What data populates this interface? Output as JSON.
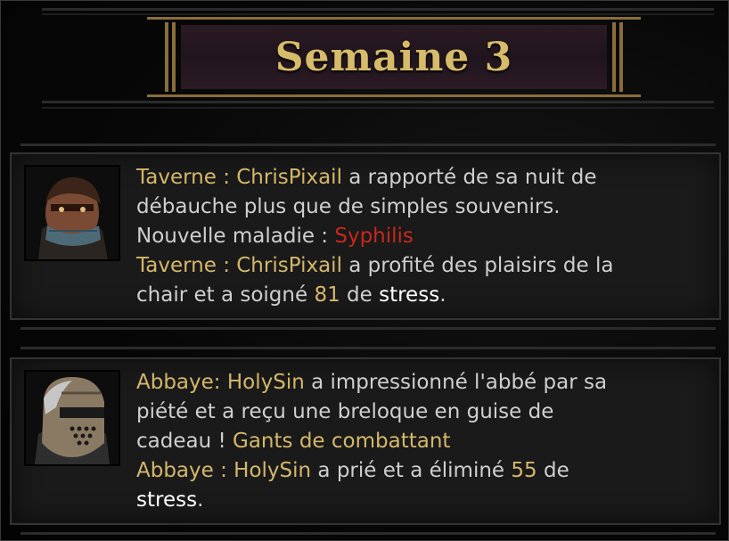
{
  "header": {
    "title": "Semaine 3"
  },
  "events": [
    {
      "hero": "ChrisPixail",
      "portrait_icon": "bandaged-hero-portrait",
      "lines": [
        {
          "place": "Taverne : ChrisPixail",
          "text": " a rapporté de sa nuit de"
        },
        {
          "text": "débauche plus que de simples souvenirs."
        },
        {
          "label": "Nouvelle maladie : ",
          "disease": "Syphilis"
        },
        {
          "place": "Taverne : ChrisPixail",
          "text": " a profité des plaisirs de la"
        },
        {
          "pre": "chair et a soigné ",
          "amount": "81",
          "mid": " de ",
          "stat": "stress",
          "post": "."
        }
      ]
    },
    {
      "hero": "HolySin",
      "portrait_icon": "crusader-helmet-portrait",
      "lines": [
        {
          "place": "Abbaye: HolySin",
          "text": " a impressionné l'abbé par sa"
        },
        {
          "text": "piété et a reçu une breloque en guise de"
        },
        {
          "pre": "cadeau ! ",
          "item": "Gants de combattant"
        },
        {
          "place": "Abbaye : HolySin",
          "text": " a prié et a éliminé ",
          "amount": "55",
          "post": " de"
        },
        {
          "stat": "stress",
          "post": "."
        }
      ]
    }
  ],
  "colors": {
    "gold": "#d4b76a",
    "disease": "#c8281c",
    "body_text": "#cfcfcf",
    "banner_bg": "#20141d"
  }
}
